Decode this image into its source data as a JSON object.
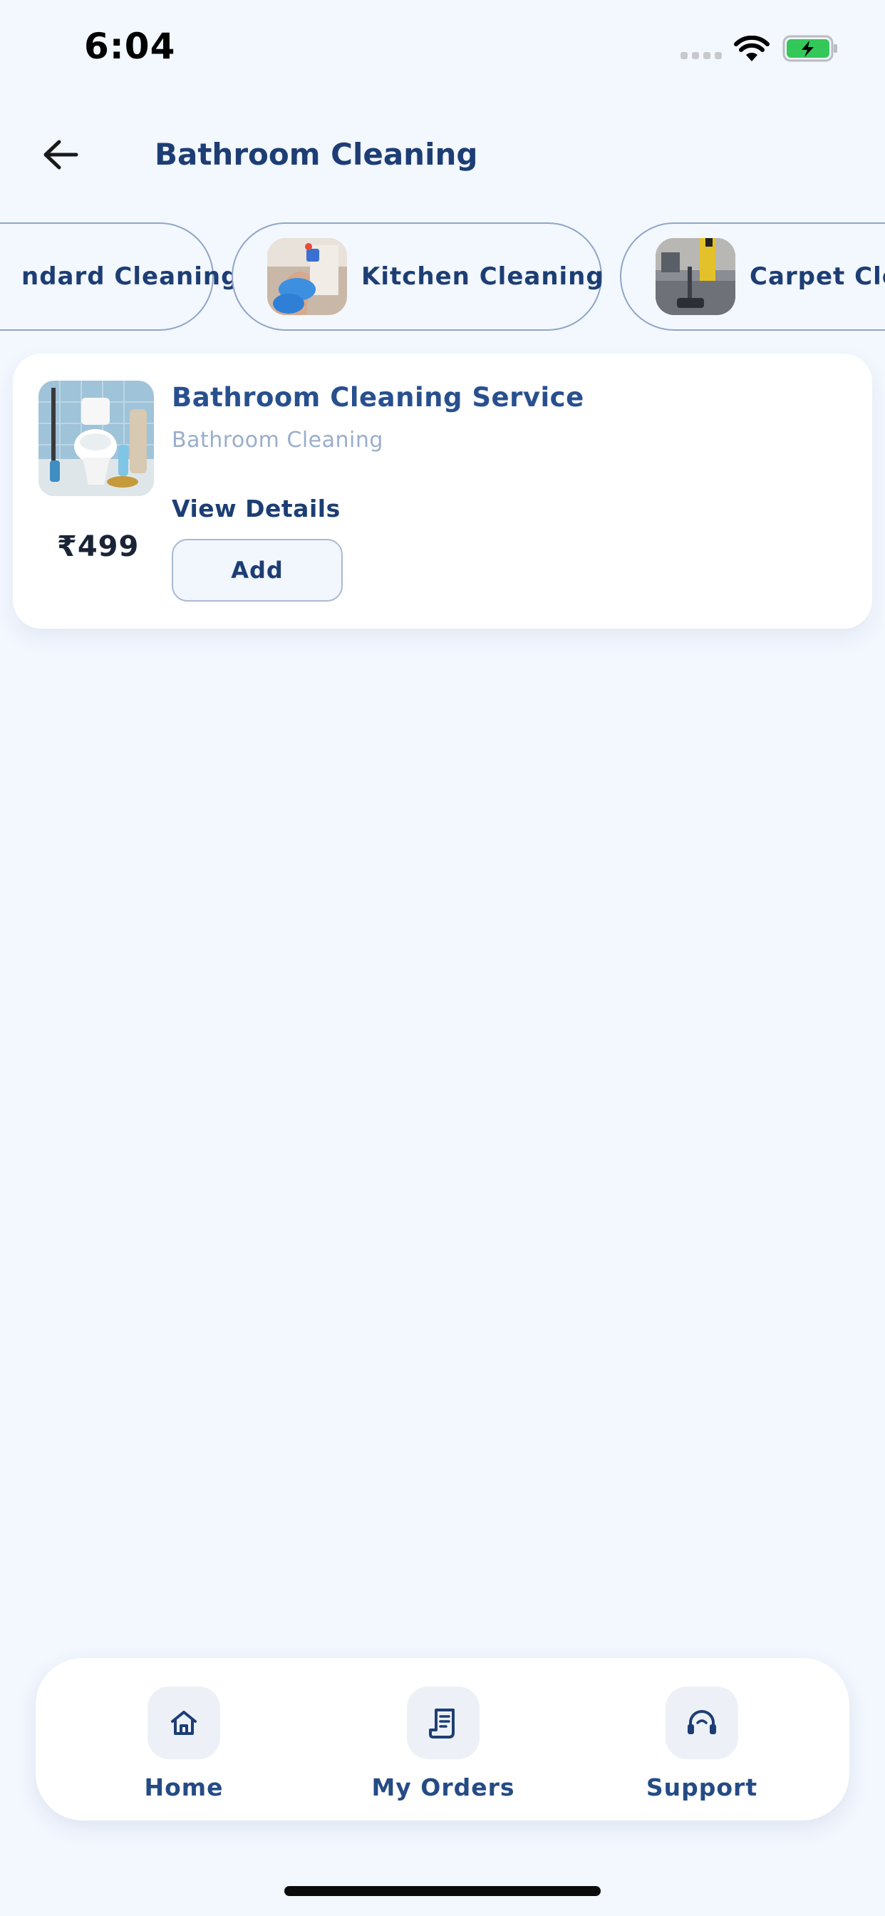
{
  "status_bar": {
    "time": "6:04"
  },
  "header": {
    "back_icon": "arrow-left-icon",
    "title": "Bathroom Cleaning"
  },
  "categories": [
    {
      "label": "Standard Cleaning",
      "visible_label": "ndard Cleaning"
    },
    {
      "label": "Kitchen Cleaning",
      "visible_label": "Kitchen Cleaning"
    },
    {
      "label": "Carpet Cleaning",
      "visible_label": "Carpet Clea"
    }
  ],
  "service": {
    "title": "Bathroom Cleaning Service",
    "subtitle": "Bathroom Cleaning",
    "price": "₹499",
    "view_details_label": "View Details",
    "add_label": "Add"
  },
  "bottom_nav": {
    "items": [
      {
        "label": "Home",
        "icon": "home-icon"
      },
      {
        "label": "My Orders",
        "icon": "receipt-icon"
      },
      {
        "label": "Support",
        "icon": "headset-icon"
      }
    ]
  },
  "colors": {
    "background": "#f3f7fe",
    "primary": "#1d3e74",
    "accent_title": "#28508e",
    "muted": "#9aaecb",
    "battery_green": "#34c759"
  }
}
